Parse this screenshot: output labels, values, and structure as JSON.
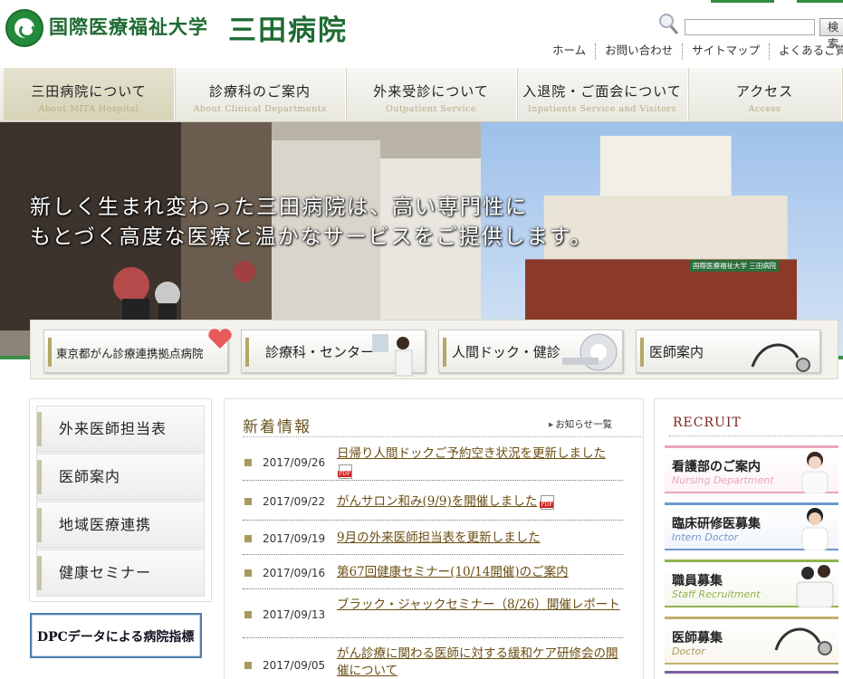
{
  "header": {
    "university": "国際医療福祉大学",
    "hospital": "三田病院",
    "search_button": "検索",
    "utility_links": [
      "ホーム",
      "お問い合わせ",
      "サイトマップ",
      "よくあるご質問"
    ]
  },
  "nav": [
    {
      "jp": "三田病院について",
      "en": "About MITA Hospital"
    },
    {
      "jp": "診療科のご案内",
      "en": "About Clinical Departments"
    },
    {
      "jp": "外来受診について",
      "en": "Outpatient Service"
    },
    {
      "jp": "入退院・ご面会について",
      "en": "Inpatients Service and Visitors"
    },
    {
      "jp": "アクセス",
      "en": "Access"
    }
  ],
  "hero": {
    "line1": "新しく生まれ変わった三田病院は、高い専門性に",
    "line2": "もとづく高度な医療と温かなサービスをご提供します。",
    "sign": "国際医療福祉大学 三田病院"
  },
  "quick_links": [
    "東京都がん診療連携拠点病院",
    "診療科・センター",
    "人間ドック・健診",
    "医師案内"
  ],
  "left_menu": [
    "外来医師担当表",
    "医師案内",
    "地域医療連携",
    "健康セミナー"
  ],
  "dpc_banner": "DPCデータによる病院指標",
  "news": {
    "title": "新着情報",
    "more": "お知らせ一覧",
    "items": [
      {
        "date": "2017/09/26",
        "title": "日帰り人間ドックご予約空き状況を更新しました"
      },
      {
        "date": "2017/09/22",
        "title": "がんサロン和み(9/9)を開催しました"
      },
      {
        "date": "2017/09/19",
        "title": "9月の外来医師担当表を更新しました"
      },
      {
        "date": "2017/09/16",
        "title": "第67回健康セミナー(10/14開催)のご案内"
      },
      {
        "date": "2017/09/13",
        "title": "ブラック・ジャックセミナー（8/26）開催レポート"
      },
      {
        "date": "2017/09/05",
        "title": "がん診療に関わる医師に対する緩和ケア研修会の開催について"
      }
    ]
  },
  "recruit": {
    "title": "RECRUIT",
    "items": [
      {
        "jp": "看護部のご案内",
        "en": "Nursing Department",
        "color": "#e7a5b8"
      },
      {
        "jp": "臨床研修医募集",
        "en": "Intern Doctor",
        "color": "#6f98cf"
      },
      {
        "jp": "職員募集",
        "en": "Staff Recruitment",
        "color": "#8fb44c"
      },
      {
        "jp": "医師募集",
        "en": "Doctor",
        "color": "#c2b06a"
      }
    ]
  },
  "colors": {
    "brand_green": "#1f6b33",
    "accent_gold": "#a89a5d",
    "link_brown": "#6b4e12"
  }
}
